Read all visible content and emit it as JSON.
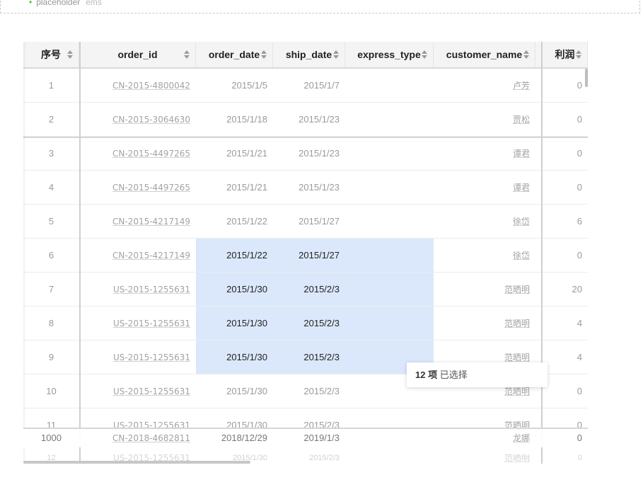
{
  "top_bar": {
    "placeholder_label": "placeholder",
    "placeholder_suffix": "ems"
  },
  "columns": [
    {
      "key": "idx",
      "label": "序号"
    },
    {
      "key": "order_id",
      "label": "order_id"
    },
    {
      "key": "order_date",
      "label": "order_date"
    },
    {
      "key": "ship_date",
      "label": "ship_date"
    },
    {
      "key": "express_type",
      "label": "express_type"
    },
    {
      "key": "customer_name",
      "label": "customer_name"
    },
    {
      "key": "profit",
      "label": "利润"
    }
  ],
  "rows": [
    {
      "idx": "1",
      "order_id": "CN-2015-4800042",
      "order_date": "2015/1/5",
      "ship_date": "2015/1/7",
      "express_type": "",
      "customer_name": "卢芳",
      "profit": "0"
    },
    {
      "idx": "2",
      "order_id": "CN-2015-3064630",
      "order_date": "2015/1/18",
      "ship_date": "2015/1/23",
      "express_type": "",
      "customer_name": "贾松",
      "profit": "0"
    },
    {
      "idx": "3",
      "order_id": "CN-2015-4497265",
      "order_date": "2015/1/21",
      "ship_date": "2015/1/23",
      "express_type": "",
      "customer_name": "谭君",
      "profit": "0"
    },
    {
      "idx": "4",
      "order_id": "CN-2015-4497265",
      "order_date": "2015/1/21",
      "ship_date": "2015/1/23",
      "express_type": "",
      "customer_name": "谭君",
      "profit": "0"
    },
    {
      "idx": "5",
      "order_id": "CN-2015-4217149",
      "order_date": "2015/1/22",
      "ship_date": "2015/1/27",
      "express_type": "",
      "customer_name": "徐岱",
      "profit": "6"
    },
    {
      "idx": "6",
      "order_id": "CN-2015-4217149",
      "order_date": "2015/1/22",
      "ship_date": "2015/1/27",
      "express_type": "",
      "customer_name": "徐岱",
      "profit": "0"
    },
    {
      "idx": "7",
      "order_id": "US-2015-1255631",
      "order_date": "2015/1/30",
      "ship_date": "2015/2/3",
      "express_type": "",
      "customer_name": "范晒明",
      "profit": "20"
    },
    {
      "idx": "8",
      "order_id": "US-2015-1255631",
      "order_date": "2015/1/30",
      "ship_date": "2015/2/3",
      "express_type": "",
      "customer_name": "范晒明",
      "profit": "4"
    },
    {
      "idx": "9",
      "order_id": "US-2015-1255631",
      "order_date": "2015/1/30",
      "ship_date": "2015/2/3",
      "express_type": "",
      "customer_name": "范晒明",
      "profit": "4"
    },
    {
      "idx": "10",
      "order_id": "US-2015-1255631",
      "order_date": "2015/1/30",
      "ship_date": "2015/2/3",
      "express_type": "",
      "customer_name": "范晒明",
      "profit": "0"
    },
    {
      "idx": "11",
      "order_id": "US-2015-1255631",
      "order_date": "2015/1/30",
      "ship_date": "2015/2/3",
      "express_type": "",
      "customer_name": "范晒明",
      "profit": "0"
    }
  ],
  "frozen_bottom_row": {
    "idx": "1000",
    "order_id": "CN-2018-4682811",
    "order_date": "2018/12/29",
    "ship_date": "2019/1/3",
    "express_type": "",
    "customer_name": "龙娜",
    "profit": "0"
  },
  "ghost_row": {
    "idx": "12",
    "order_id": "US-2015-1255631",
    "order_date": "2015/1/30",
    "ship_date": "2015/2/3",
    "express_type": "",
    "customer_name": "范晒明",
    "profit": "0"
  },
  "selected_rows": [
    5,
    6,
    7,
    8
  ],
  "selection_tooltip": {
    "count": "12 项",
    "label": "已选择"
  },
  "colors": {
    "selection": "#dbe8fb",
    "header_bg": "#f4f4f4"
  }
}
